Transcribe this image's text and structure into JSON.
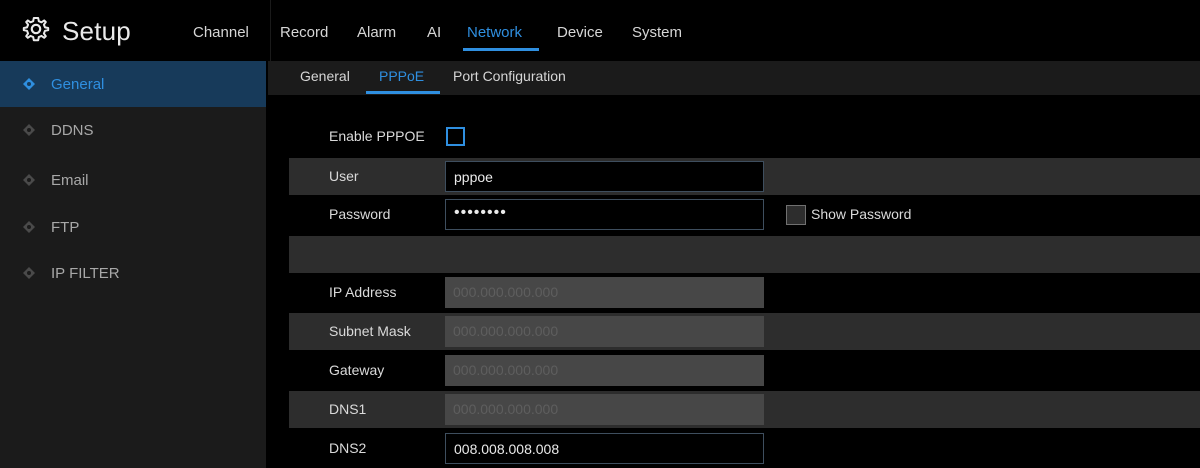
{
  "header": {
    "title": "Setup",
    "menu": [
      "Channel",
      "Record",
      "Alarm",
      "AI",
      "Network",
      "Device",
      "System"
    ],
    "active_menu": "Network"
  },
  "sidebar": {
    "items": [
      {
        "label": "General",
        "active": true
      },
      {
        "label": "DDNS",
        "active": false
      },
      {
        "label": "Email",
        "active": false
      },
      {
        "label": "FTP",
        "active": false
      },
      {
        "label": "IP FILTER",
        "active": false
      }
    ]
  },
  "subtabs": {
    "items": [
      "General",
      "PPPoE",
      "Port Configuration"
    ],
    "active": "PPPoE"
  },
  "form": {
    "enable_pppoe_label": "Enable PPPOE",
    "enable_pppoe_checked": false,
    "user_label": "User",
    "user_value": "pppoe",
    "password_label": "Password",
    "password_value": "••••••••",
    "show_password_label": "Show Password",
    "show_password_checked": false,
    "ip_address_label": "IP Address",
    "ip_address_value": "000.000.000.000",
    "subnet_mask_label": "Subnet Mask",
    "subnet_mask_value": "000.000.000.000",
    "gateway_label": "Gateway",
    "gateway_value": "000.000.000.000",
    "dns1_label": "DNS1",
    "dns1_value": "000.000.000.000",
    "dns2_label": "DNS2",
    "dns2_value": "008.008.008.008"
  },
  "colors": {
    "accent": "#2f8fe0",
    "sidebar_bg": "#1b1b1b",
    "active_bg": "#173a5a",
    "row_grey": "#2d2d2d",
    "disabled_input": "#474747"
  },
  "icons": {
    "brand": "gear-icon",
    "sidebar_item": "diamond-bullet-icon"
  }
}
